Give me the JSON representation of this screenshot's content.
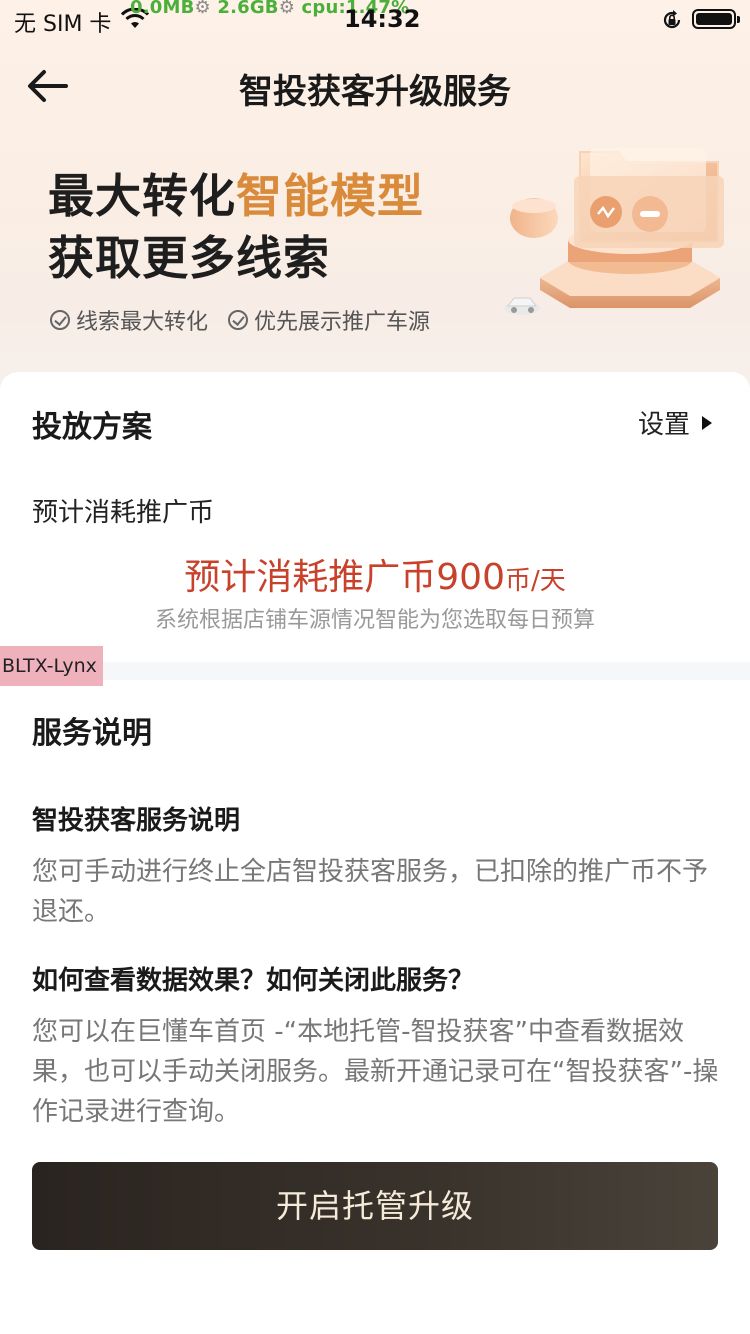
{
  "status_bar": {
    "carrier": "无 SIM 卡",
    "stats_mem": "0.0MB",
    "stats_disk": "2.6GB",
    "stats_cpu": "cpu:1.47%",
    "time": "14:32"
  },
  "nav": {
    "title": "智投获客升级服务"
  },
  "hero": {
    "line1_plain": "最大转化",
    "line1_accent": "智能模型",
    "line2": "获取更多线索",
    "tags": [
      "线索最大转化",
      "优先展示推广车源"
    ],
    "accent_color": "#d98a3a"
  },
  "plan": {
    "title": "投放方案",
    "settings_label": "设置",
    "estimate_label": "预计消耗推广币",
    "estimate_prefix": "预计消耗推广币",
    "estimate_amount": "900",
    "estimate_unit": "币/天",
    "estimate_color": "#c8412a",
    "note": "系统根据店铺车源情况智能为您选取每日预算"
  },
  "watermark": "BLTX-Lynx",
  "service": {
    "title": "服务说明",
    "items": [
      {
        "question": "智投获客服务说明",
        "answer": "您可手动进行终止全店智投获客服务，已扣除的推广币不予退还。"
      },
      {
        "question": "如何查看数据效果？如何关闭此服务？",
        "answer": "您可以在巨懂车首页 -“本地托管-智投获客”中查看数据效果，也可以手动关闭服务。最新开通记录可在“智投获客”-操作记录进行查询。"
      }
    ]
  },
  "cta": {
    "label": "开启托管升级"
  }
}
